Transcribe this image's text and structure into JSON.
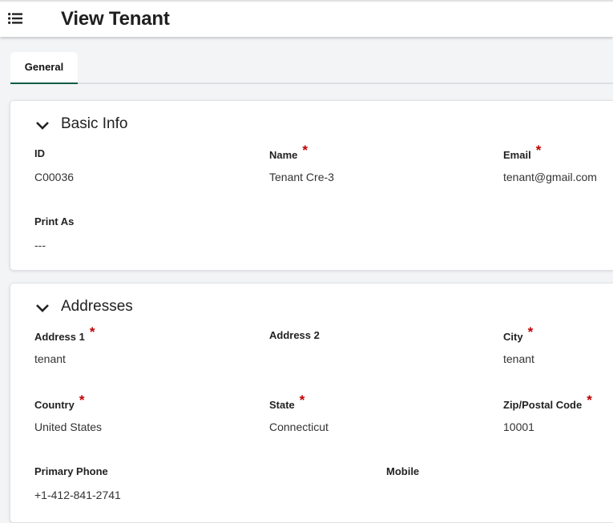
{
  "header": {
    "title": "View Tenant",
    "menu_icon": "list-icon"
  },
  "tabs": [
    {
      "label": "General",
      "active": true
    }
  ],
  "colors": {
    "accent": "#0d5c46",
    "required": "#c00000"
  },
  "basic_info": {
    "title": "Basic Info",
    "fields": {
      "id": {
        "label": "ID",
        "value": "C00036",
        "required": false
      },
      "name": {
        "label": "Name",
        "value": "Tenant Cre-3",
        "required": true
      },
      "email": {
        "label": "Email",
        "value": "tenant@gmail.com",
        "required": true
      },
      "print_as": {
        "label": "Print As",
        "value": "---",
        "required": false
      }
    }
  },
  "addresses": {
    "title": "Addresses",
    "fields": {
      "address1": {
        "label": "Address 1",
        "value": "tenant",
        "required": true
      },
      "address2": {
        "label": "Address 2",
        "value": "",
        "required": false
      },
      "city": {
        "label": "City",
        "value": "tenant",
        "required": true
      },
      "country": {
        "label": "Country",
        "value": "United States",
        "required": true
      },
      "state": {
        "label": "State",
        "value": "Connecticut",
        "required": true
      },
      "zip": {
        "label": "Zip/Postal Code",
        "value": "10001",
        "required": true
      },
      "primary_phone": {
        "label": "Primary Phone",
        "value": "+1-412-841-2741",
        "required": false
      },
      "mobile": {
        "label": "Mobile",
        "value": "",
        "required": false
      }
    }
  },
  "required_marker": "*"
}
